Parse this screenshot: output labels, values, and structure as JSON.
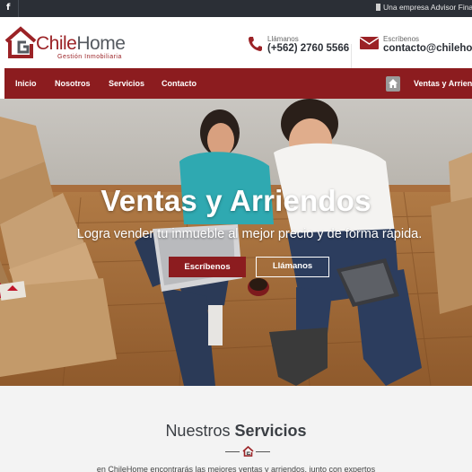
{
  "topbar": {
    "facebook": "f",
    "company": "Una empresa Advisor Financial"
  },
  "brand": {
    "chile": "Chile",
    "home": "Home",
    "tagline": "Gestión Inmobiliaria"
  },
  "contact": {
    "phone_label": "Llámanos",
    "phone_value": "(+562) 2760 5566",
    "mail_label": "Escríbenos",
    "mail_value": "contacto@chilehome"
  },
  "nav": {
    "items": [
      {
        "label": "Inicio"
      },
      {
        "label": "Nosotros"
      },
      {
        "label": "Servicios"
      },
      {
        "label": "Contacto"
      }
    ],
    "breadcrumb_current": "Ventas y Arriendos"
  },
  "hero": {
    "title": "Ventas y Arriendos",
    "subtitle": "Logra vender tu inmueble al mejor precio y de forma rápida.",
    "primary_button": "Escríbenos",
    "secondary_button": "Llámanos"
  },
  "services": {
    "title_light": "Nuestros",
    "title_bold": "Servicios",
    "intro": "en ChileHome encontrarás las mejores ventas y arriendos, junto con expertos"
  },
  "colors": {
    "brand_red": "#8c1c1f",
    "dark_bar": "#2b2f36",
    "section_bg": "#f3f3f3"
  },
  "icons": [
    "facebook-icon",
    "building-icon",
    "house-logo-icon",
    "phone-icon",
    "mail-icon",
    "home-icon"
  ]
}
